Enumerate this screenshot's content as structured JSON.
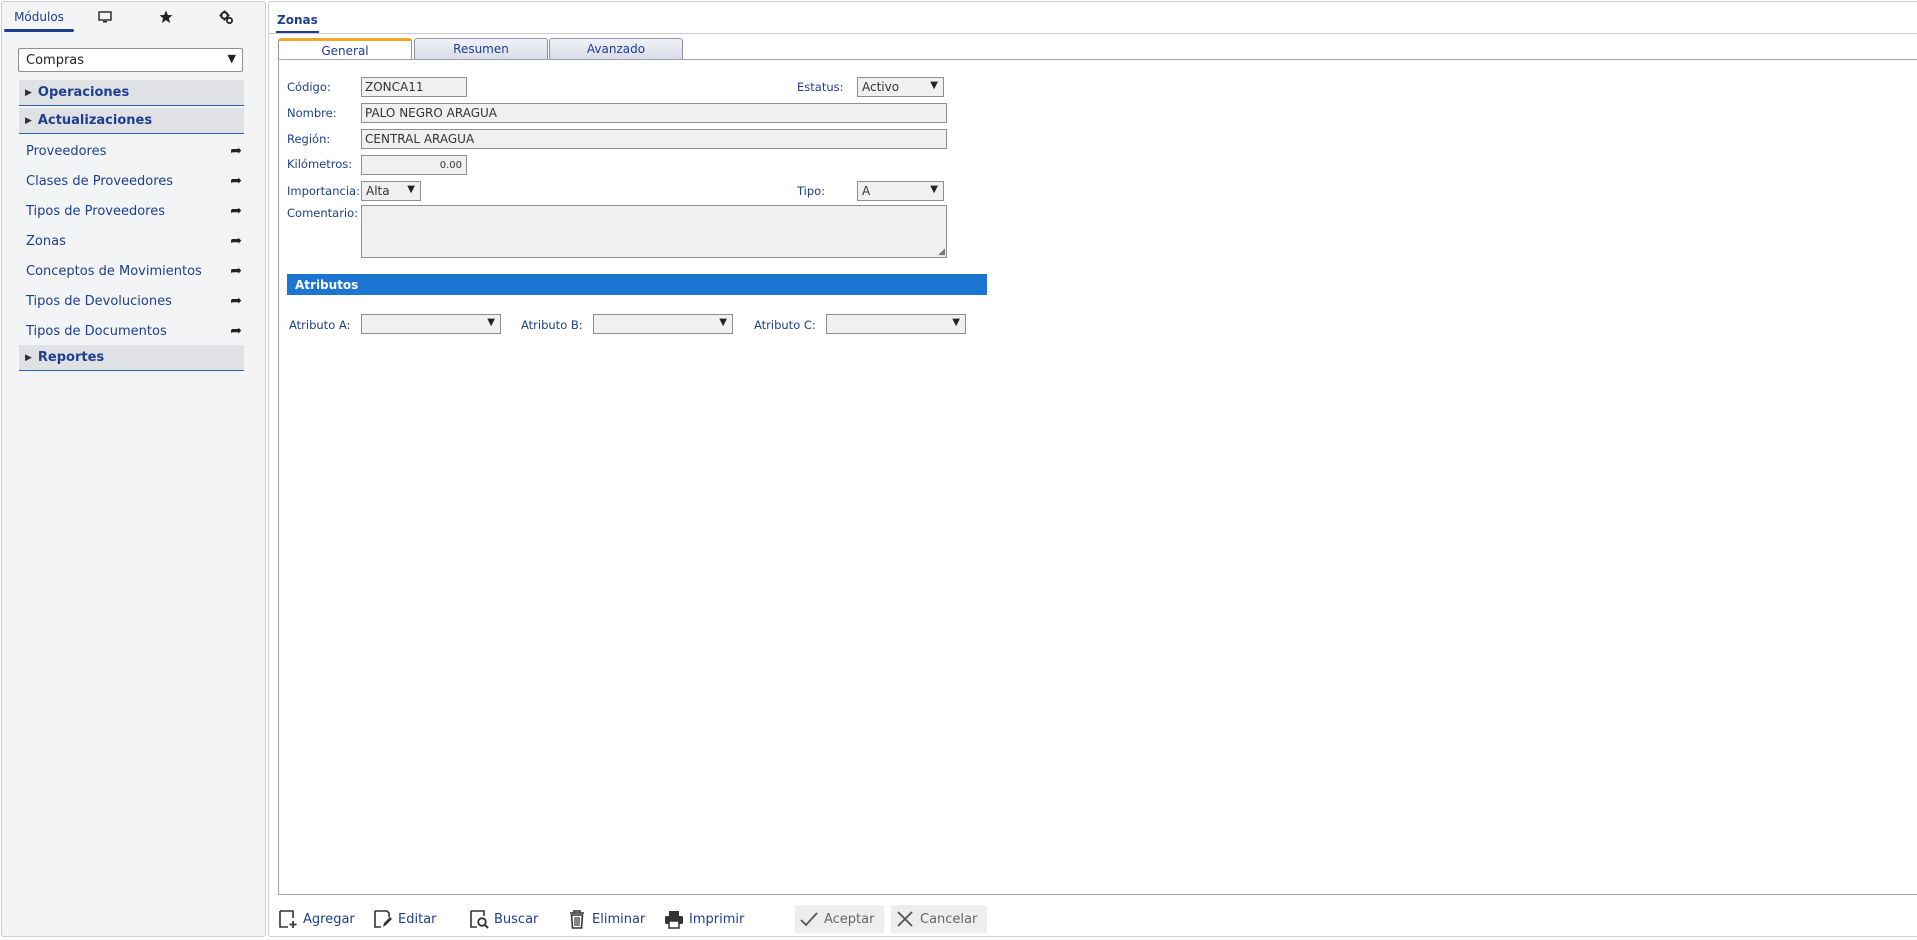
{
  "sidebar": {
    "tabs": [
      {
        "label": "Módulos",
        "active": true
      },
      {
        "icon": "monitor-icon"
      },
      {
        "icon": "star-icon"
      },
      {
        "icon": "gears-icon"
      }
    ],
    "module": "Compras",
    "sections": {
      "operaciones": "Operaciones",
      "actualizaciones": "Actualizaciones",
      "reportes": "Reportes"
    },
    "items": [
      "Proveedores",
      "Clases de Proveedores",
      "Tipos de Proveedores",
      "Zonas",
      "Conceptos de Movimientos",
      "Tipos de Devoluciones",
      "Tipos de Documentos"
    ]
  },
  "page": {
    "tab": "Zonas",
    "form_tabs": [
      "General",
      "Resumen",
      "Avanzado"
    ],
    "active_form_tab": "General"
  },
  "form": {
    "codigo_label": "Código:",
    "codigo": "ZONCA11",
    "estatus_label": "Estatus:",
    "estatus": "Activo",
    "nombre_label": "Nombre:",
    "nombre": "PALO NEGRO ARAGUA",
    "region_label": "Región:",
    "region": "CENTRAL ARAGUA",
    "kilometros_label": "Kilómetros:",
    "kilometros": "0.00",
    "importancia_label": "Importancia:",
    "importancia": "Alta",
    "tipo_label": "Tipo:",
    "tipo": "A",
    "comentario_label": "Comentario:",
    "comentario": ""
  },
  "atributos": {
    "title": "Atributos",
    "a_label": "Atributo A:",
    "b_label": "Atributo B:",
    "c_label": "Atributo C:",
    "a": "",
    "b": "",
    "c": ""
  },
  "toolbar": {
    "agregar": "Agregar",
    "editar": "Editar",
    "buscar": "Buscar",
    "eliminar": "Eliminar",
    "imprimir": "Imprimir",
    "aceptar": "Aceptar",
    "cancelar": "Cancelar"
  },
  "colors": {
    "accent": "#1e3f8f",
    "attr_bar": "#1b75d1",
    "active_tab_top": "#f0a629"
  }
}
